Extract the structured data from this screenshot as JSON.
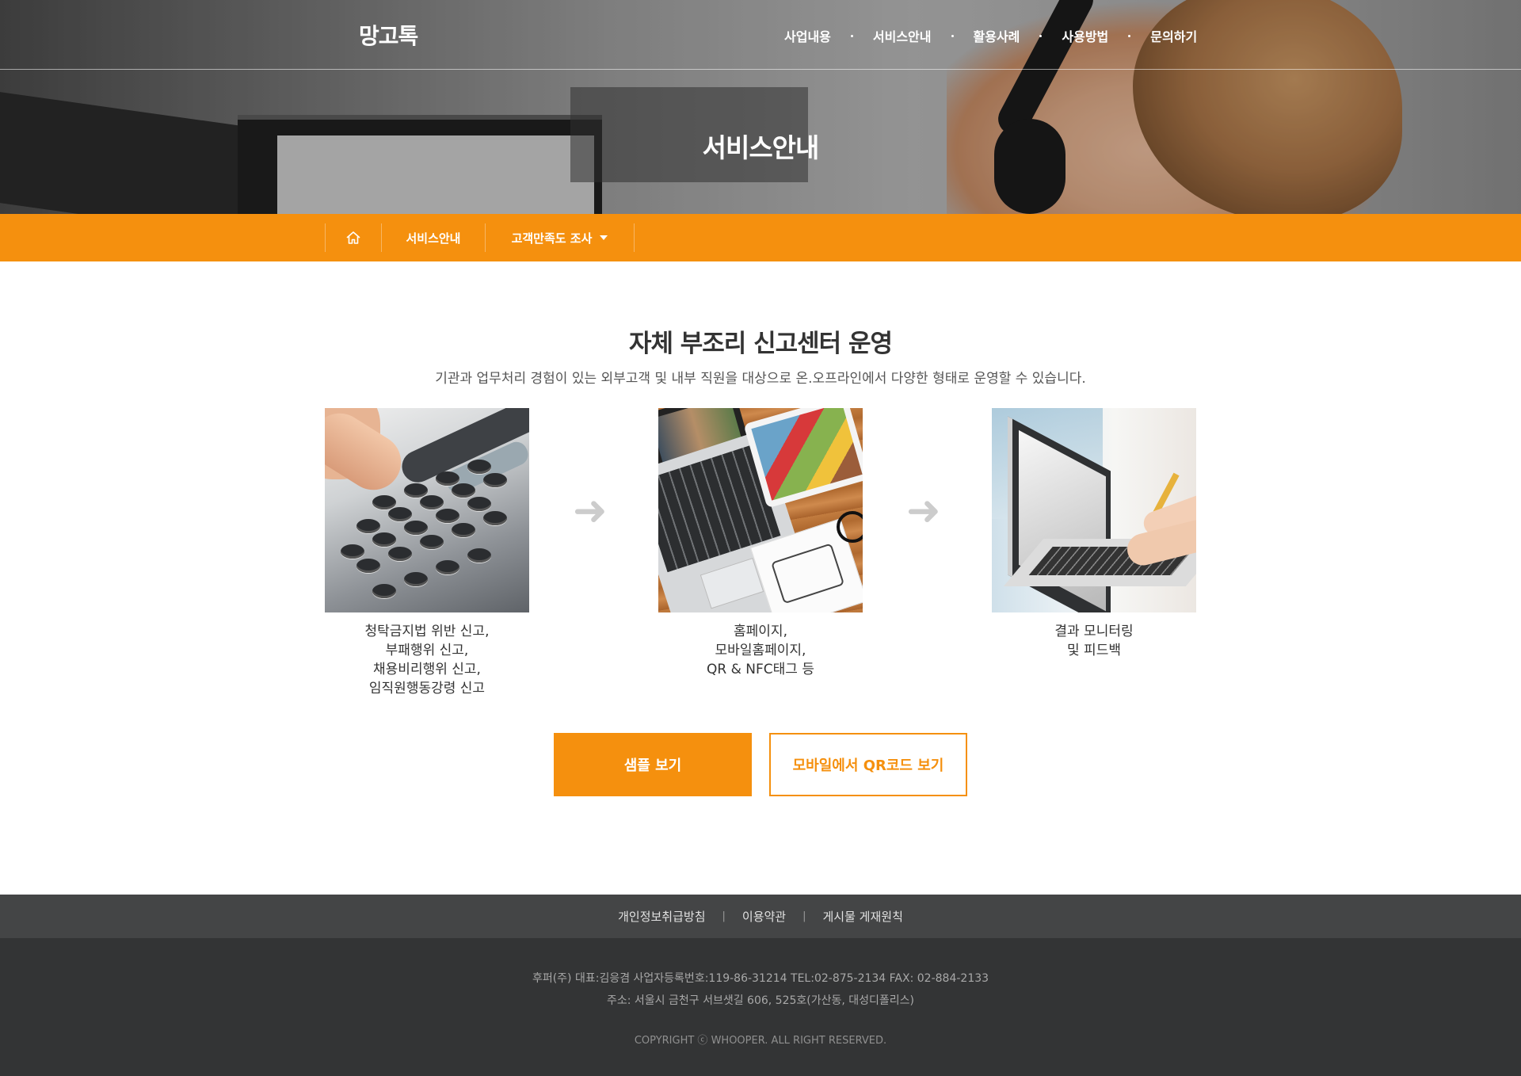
{
  "header": {
    "logo": "망고톡",
    "nav": [
      "사업내용",
      "서비스안내",
      "활용사례",
      "사용방법",
      "문의하기"
    ],
    "hero_title": "서비스안내"
  },
  "subnav": {
    "home_icon": "home-icon",
    "level1": "서비스안내",
    "level2": "고객만족도 조사",
    "dropdown_icon": "caret-down-icon"
  },
  "section": {
    "title": "자체 부조리 신고센터 운영",
    "description": "기관과 업무처리 경험이 있는 외부고객 및 내부 직원을 대상으로 온.오프라인에서 다양한 형태로 운영할 수 있습니다.",
    "arrow_icon": "arrow-right-icon",
    "steps": [
      {
        "image": "phone-keypad-photo",
        "caption": [
          "청탁금지법 위반 신고,",
          "부패행위 신고,",
          "채용비리행위 신고,",
          "임직원행동강령 신고"
        ]
      },
      {
        "image": "laptop-tablet-photo",
        "caption": [
          "홈페이지,",
          "모바일홈페이지,",
          "QR & NFC태그 등"
        ]
      },
      {
        "image": "laptop-typing-photo",
        "caption": [
          "결과 모니터링",
          "및 피드백"
        ]
      }
    ]
  },
  "buttons": {
    "sample": "샘플 보기",
    "qr": "모바일에서 QR코드 보기"
  },
  "footer": {
    "links": [
      "개인정보취급방침",
      "이용약관",
      "게시물 게재원칙"
    ],
    "separator": "|",
    "company_line": "후퍼(주)   대표:김응겸   사업자등록번호:119-86-31214   TEL:02-875-2134   FAX: 02-884-2133",
    "address_line": "주소: 서울시 금천구 서브샛길 606, 525호(가산동, 대성디폴리스)",
    "copyright": "COPYRIGHT ⓒ WHOOPER. ALL RIGHT RESERVED."
  },
  "colors": {
    "accent": "#f5900e",
    "footer_links_bg": "#444546",
    "footer_info_bg": "#333435"
  }
}
